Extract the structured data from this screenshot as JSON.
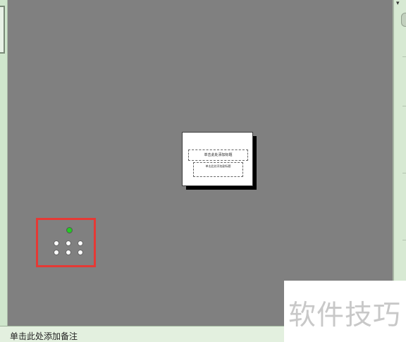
{
  "slide": {
    "title_placeholder": "单击此处添加标题",
    "subtitle_placeholder": "单击此处添加副标题"
  },
  "notes": {
    "placeholder": "单击此处添加备注"
  },
  "watermark": {
    "text": "软件技巧"
  },
  "highlight": {
    "color": "#e53935",
    "rotation_handle_color": "#22cc22"
  }
}
